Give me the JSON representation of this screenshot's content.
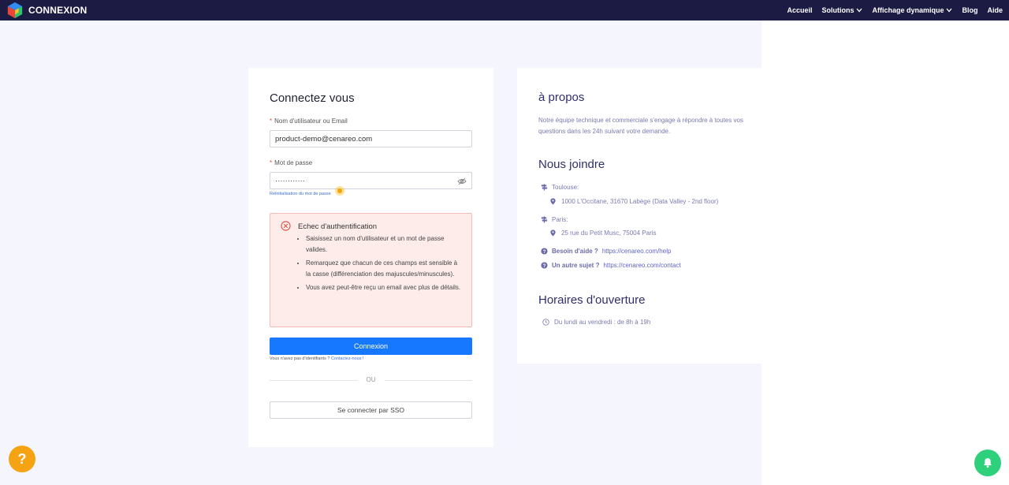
{
  "header": {
    "brand": "CONNEXION",
    "nav": [
      {
        "label": "Accueil"
      },
      {
        "label": "Solutions"
      },
      {
        "label": "Affichage dynamique"
      },
      {
        "label": "Blog"
      },
      {
        "label": "Aide"
      }
    ],
    "chevron": "v"
  },
  "login": {
    "title": "Connectez vous",
    "required_mark": "*",
    "username_label": "Nom d'utilisateur ou Email",
    "username_value": "product-demo@cenareo.com",
    "password_label": "Mot de passe",
    "password_value": "············",
    "reset_link": "Réinitialisation du mot de passe",
    "error": {
      "title": "Echec d'authentification",
      "items": [
        "Saisissez un nom d'utilisateur et un mot de passe valides.",
        "Remarquez que chacun de ces champs est sensible à la casse (différenciation des majuscules/minuscules).",
        "Vous avez peut-être reçu un email avec plus de détails."
      ]
    },
    "submit_label": "Connexion",
    "no_account_text": "Vous n'avez pas d'identifiants ?",
    "contact_link": "Contactez-nous !",
    "or_label": "OU",
    "sso_label": "Se connecter par SSO"
  },
  "about": {
    "title": "à propos",
    "text": "Notre équipe technique et commerciale s'engage à répondre à toutes vos questions dans les 24h suivant votre demande.",
    "join_title": "Nous joindre",
    "offices": [
      {
        "city": "Toulouse:",
        "address": "1000 L'Occitane, 31670 Labège (Data Valley - 2nd floor)"
      },
      {
        "city": "Paris:",
        "address": "25 rue du Petit Musc, 75004 Paris"
      }
    ],
    "help_label": "Besoin d'aide ?",
    "help_link": "https://cenareo.com/help",
    "other_label": "Un autre sujet ?",
    "other_link": "https://cenareo.com/contact",
    "hours_title": "Horaires d'ouverture",
    "hours_text": "Du lundi au vendredi : de 8h à 19h"
  },
  "fab": {
    "help_glyph": "?"
  },
  "colors": {
    "topbar": "#1c1b44",
    "primary": "#1677ff",
    "error_bg": "#fdecea",
    "help_fab": "#f6a313",
    "notif_fab": "#2fd07b"
  }
}
